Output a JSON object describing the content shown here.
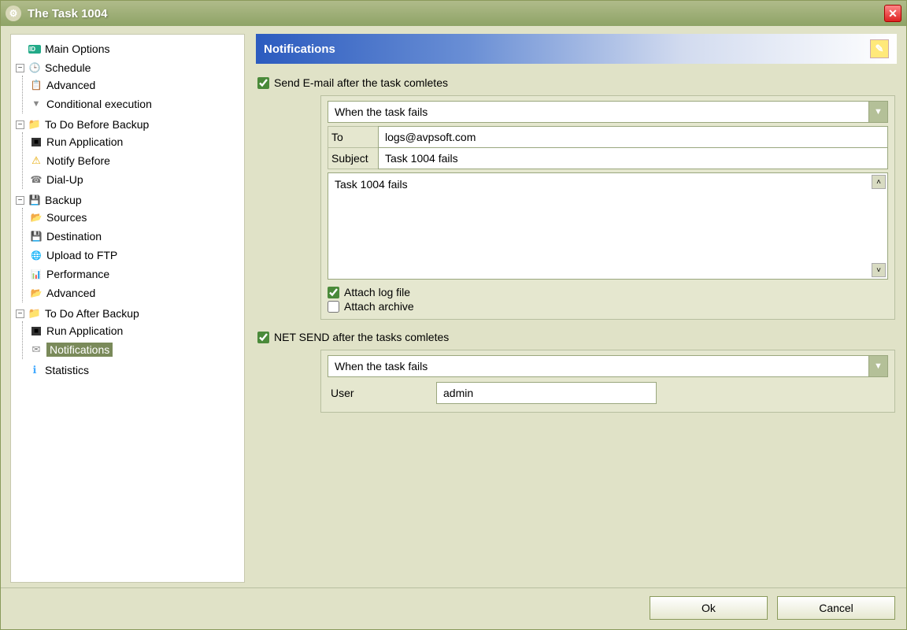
{
  "window": {
    "title": "The Task 1004"
  },
  "sidebar": {
    "items": [
      {
        "label": "Main Options"
      },
      {
        "label": "Schedule",
        "children": [
          {
            "label": "Advanced"
          },
          {
            "label": "Conditional execution"
          }
        ]
      },
      {
        "label": "To Do Before Backup",
        "children": [
          {
            "label": "Run Application"
          },
          {
            "label": "Notify Before"
          },
          {
            "label": "Dial-Up"
          }
        ]
      },
      {
        "label": "Backup",
        "children": [
          {
            "label": "Sources"
          },
          {
            "label": "Destination"
          },
          {
            "label": "Upload to FTP"
          },
          {
            "label": "Performance"
          },
          {
            "label": "Advanced"
          }
        ]
      },
      {
        "label": "To Do After Backup",
        "children": [
          {
            "label": "Run Application"
          },
          {
            "label": "Notifications"
          }
        ]
      },
      {
        "label": "Statistics"
      }
    ]
  },
  "panel": {
    "title": "Notifications"
  },
  "email": {
    "checkbox_label": "Send E-mail after the task comletes",
    "checked": true,
    "when": "When the task fails",
    "to_label": "To",
    "to_value": "logs@avpsoft.com",
    "subject_label": "Subject",
    "subject_value": "Task 1004 fails",
    "body": "Task 1004 fails",
    "attach_log_label": "Attach log file",
    "attach_log_checked": true,
    "attach_archive_label": "Attach archive",
    "attach_archive_checked": false
  },
  "netsend": {
    "checkbox_label": "NET SEND after the tasks comletes",
    "checked": true,
    "when": "When the task fails",
    "user_label": "User",
    "user_value": "admin"
  },
  "buttons": {
    "ok": "Ok",
    "cancel": "Cancel"
  }
}
